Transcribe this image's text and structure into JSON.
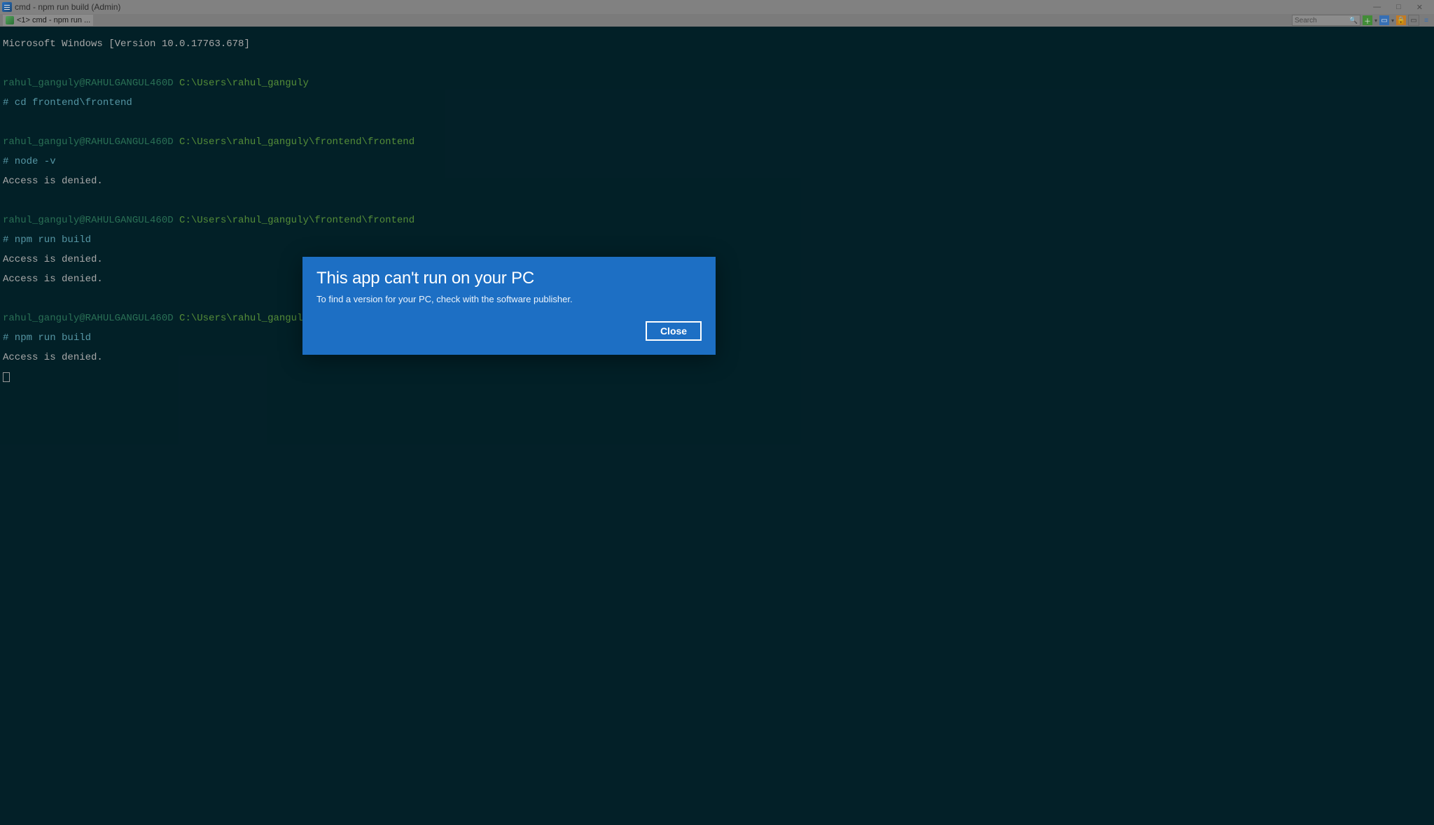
{
  "window": {
    "title": "cmd - npm  run build (Admin)",
    "minimize": "—",
    "maximize": "□",
    "close": "✕"
  },
  "tab": {
    "label": "<1> cmd - npm  run ..."
  },
  "search": {
    "placeholder": "Search"
  },
  "blocks": [
    {
      "version": "Microsoft Windows [Version 10.0.17763.678]"
    },
    {
      "user": "rahul_ganguly@RAHULGANGUL460D",
      "path": "C:\\Users\\rahul_ganguly",
      "cmd": "# cd frontend\\frontend"
    },
    {
      "user": "rahul_ganguly@RAHULGANGUL460D",
      "path": "C:\\Users\\rahul_ganguly\\frontend\\frontend",
      "cmd": "# node -v",
      "out1": "Access is denied."
    },
    {
      "user": "rahul_ganguly@RAHULGANGUL460D",
      "path": "C:\\Users\\rahul_ganguly\\frontend\\frontend",
      "cmd": "# npm run build",
      "out1": "Access is denied.",
      "out2": "Access is denied."
    },
    {
      "user": "rahul_ganguly@RAHULGANGUL460D",
      "path": "C:\\Users\\rahul_ganguly\\frontend\\frontend",
      "cmd": "# npm run build",
      "out1": "Access is denied."
    }
  ],
  "dialog": {
    "title": "This app can't run on your PC",
    "body": "To find a version for your PC, check with the software publisher.",
    "close": "Close"
  }
}
